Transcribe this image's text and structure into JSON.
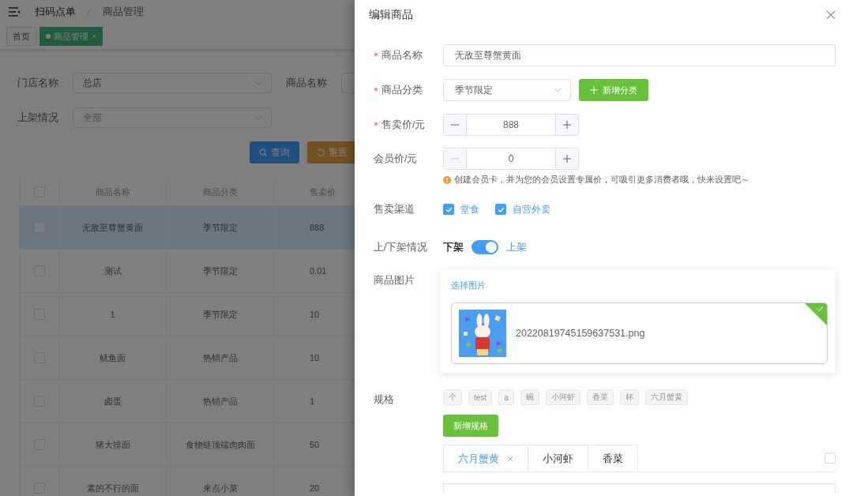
{
  "header": {
    "breadcrumb": [
      "扫码点单",
      "商品管理"
    ]
  },
  "page_tabs": [
    {
      "label": "首页",
      "selected": false
    },
    {
      "label": "商品管理",
      "selected": true
    }
  ],
  "filters": [
    {
      "label": "门店名称",
      "value": "总店"
    },
    {
      "label": "商品名称"
    },
    {
      "label": "上架情况",
      "placeholder": "全部"
    }
  ],
  "filter_buttons": [
    {
      "label": "查询",
      "kind": "primary"
    },
    {
      "label": "重置",
      "kind": "warning"
    }
  ],
  "table": {
    "columns": [
      "商品名称",
      "商品分类",
      "售卖价"
    ],
    "select_all_checked": false,
    "rows": [
      {
        "cells": [
          "无敌至尊蟹黄面",
          "季节限定",
          "888"
        ],
        "selected": true,
        "checked": false
      },
      {
        "cells": [
          "测试",
          "季节限定",
          "0.01"
        ],
        "selected": false,
        "checked": false
      },
      {
        "cells": [
          "1",
          "季节限定",
          "10"
        ],
        "selected": false,
        "checked": false
      },
      {
        "cells": [
          "鱿鱼面",
          "热销产品",
          "10"
        ],
        "selected": false,
        "checked": false
      },
      {
        "cells": [
          "卤蛋",
          "热销产品",
          "1"
        ],
        "selected": false,
        "checked": false
      },
      {
        "cells": [
          "猪大排面",
          "食物链顶端肉肉面",
          "50"
        ],
        "selected": false,
        "checked": false
      },
      {
        "cells": [
          "素的不行的面",
          "来点小菜",
          "20"
        ],
        "selected": false,
        "checked": false
      }
    ]
  },
  "drawer": {
    "title": "编辑商品",
    "fields": [
      {
        "kind": "text",
        "label": "商品名称",
        "required": true,
        "value": "无敌至尊蟹黄面"
      },
      {
        "kind": "select",
        "label": "商品分类",
        "required": true,
        "value": "季节限定",
        "button": "新增分类"
      },
      {
        "kind": "number",
        "label": "售卖价/元",
        "required": true,
        "value": "888",
        "minus_disabled": false
      },
      {
        "kind": "number",
        "label": "会员价/元",
        "required": false,
        "value": "0",
        "minus_disabled": true,
        "hint": "创建会员卡，并为您的会员设置专属价，可吸引更多消费者哦，快来设置吧～"
      },
      {
        "kind": "checkboxes",
        "label": "售卖渠道",
        "options": [
          {
            "label": "堂食",
            "checked": true
          },
          {
            "label": "自营外卖",
            "checked": true
          }
        ]
      },
      {
        "kind": "switch",
        "label": "上/下架情况",
        "off_text": "下架",
        "on_text": "上架",
        "on": true
      },
      {
        "kind": "upload",
        "label": "商品图片",
        "link": "选择图片",
        "files": [
          {
            "name": "20220819745159637531.png",
            "uploaded": true
          }
        ]
      },
      {
        "kind": "specs",
        "label": "规格",
        "tags": [
          "个",
          "test",
          "a",
          "碗",
          "小河虾",
          "香菜",
          "杯",
          "六月蟹黄"
        ],
        "button": "新增规格",
        "tabs": [
          {
            "label": "六月蟹黄",
            "selected": true
          },
          {
            "label": "小河虾",
            "selected": false
          },
          {
            "label": "香菜",
            "selected": false
          }
        ]
      }
    ]
  }
}
